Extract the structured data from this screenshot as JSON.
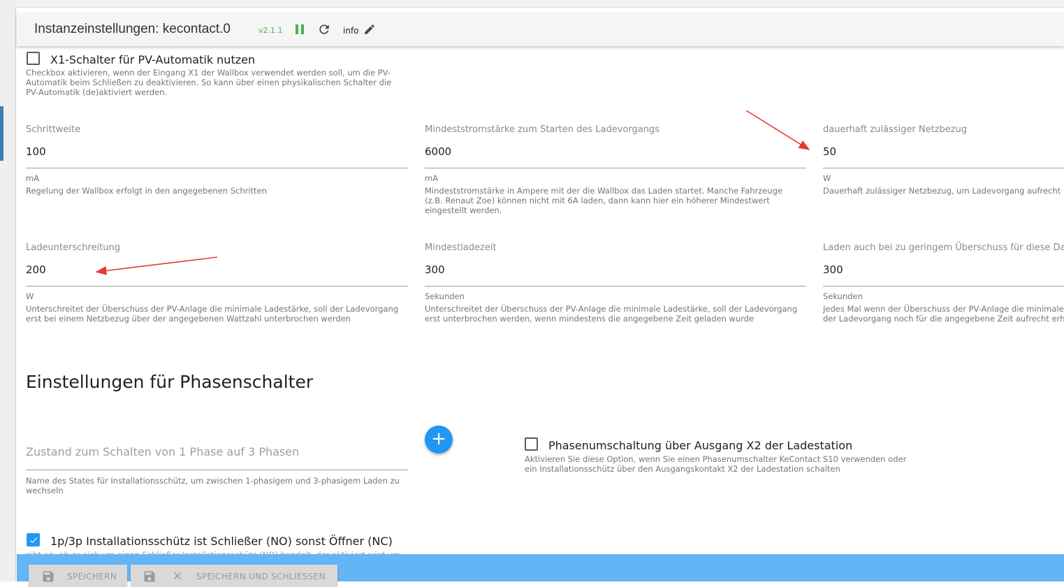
{
  "header": {
    "title": "Instanzeinstellungen: kecontact.0",
    "version": "v2.1.1",
    "info_label": "info"
  },
  "x1_switch": {
    "label": "X1-Schalter für PV-Automatik nutzen",
    "help_lines": [
      "Checkbox aktivieren, wenn der Eingang X1 der Wallbox verwendet werden soll, um die PV-",
      "Automatik beim Schließen zu deaktivieren. So kann über einen physikalischen Schalter die",
      "PV-Automatik (de)aktiviert werden."
    ]
  },
  "fields": {
    "schrittweite": {
      "label": "Schrittweite",
      "value": "100",
      "unit": "mA",
      "help_lines": [
        "Regelung der Wallbox erfolgt in den angegebenen Schritten"
      ]
    },
    "mindeststrom": {
      "label": "Mindeststromstärke zum Starten des Ladevorgangs",
      "value": "6000",
      "unit": "mA",
      "help_lines": [
        "Mindeststromstärke in Ampere mit der die Wallbox das Laden startet. Manche Fahrzeuge",
        "(z.B. Renaut Zoe) können nicht mit 6A laden, dann kann hier ein höherer Mindestwert",
        "eingestellt werden."
      ]
    },
    "netzbezug": {
      "label": "dauerhaft zulässiger Netzbezug",
      "value": "50",
      "unit": "W",
      "help_lines": [
        "Dauerhaft zulässiger Netzbezug, um Ladevorgang aufrecht"
      ]
    },
    "ladeunterschreitung": {
      "label": "Ladeunterschreitung",
      "value": "200",
      "unit": "W",
      "help_lines": [
        "Unterschreitet der Überschuss der PV-Anlage die minimale Ladestärke, soll der Ladevorgang",
        "erst bei einem Netzbezug über der angegebenen Wattzahl unterbrochen werden"
      ]
    },
    "mindestladezeit": {
      "label": "Mindestladezeit",
      "value": "300",
      "unit": "Sekunden",
      "help_lines": [
        "Unterschreitet der Überschuss der PV-Anlage die minimale Ladestärke, soll der Ladevorgang",
        "erst unterbrochen werden, wenn mindestens die angegebene Zeit geladen wurde"
      ]
    },
    "nachlauf": {
      "label": "Laden auch bei zu geringem Überschuss für diese Daue",
      "value": "300",
      "unit": "Sekunden",
      "help_lines": [
        "Jedes Mal wenn der Überschuss der PV-Anlage die minimale",
        "der Ladevorgang noch für die angegebene Zeit aufrecht erh"
      ]
    }
  },
  "phase_section": {
    "title": "Einstellungen für Phasenschalter",
    "state_field": {
      "placeholder": "Zustand zum Schalten von 1 Phase auf 3 Phasen",
      "help_lines": [
        "Name des States für Installationsschütz, um zwischen 1-phasigem und 3-phasigem Laden zu",
        "wechseln"
      ]
    },
    "add_button": "+",
    "x2_switch": {
      "label": "Phasenumschaltung über Ausgang X2 der Ladestation",
      "help_lines": [
        "Aktivieren Sie diese Option, wenn Sie einen Phasenumschalter KeContact S10 verwenden oder",
        "ein Installationsschütz über den Ausgangskontakt X2 der Ladestation schalten"
      ]
    },
    "no_nc_switch": {
      "label": "1p/3p Installationsschütz ist Schließer (NO) sonst Öffner (NC)",
      "help_partial": "gibt an, ob es sich um einen Schließer-Installationsschütz (NO) handelt, der aktiviert wird um"
    }
  },
  "footer": {
    "save_label": "SPEICHERN",
    "save_close_label": "SPEICHERN UND SCHLIESSEN"
  },
  "colors": {
    "accent": "#2196f3",
    "running": "#4caf50",
    "bottom_bar": "#64b5f6",
    "annotation_arrow": "#e53935"
  }
}
